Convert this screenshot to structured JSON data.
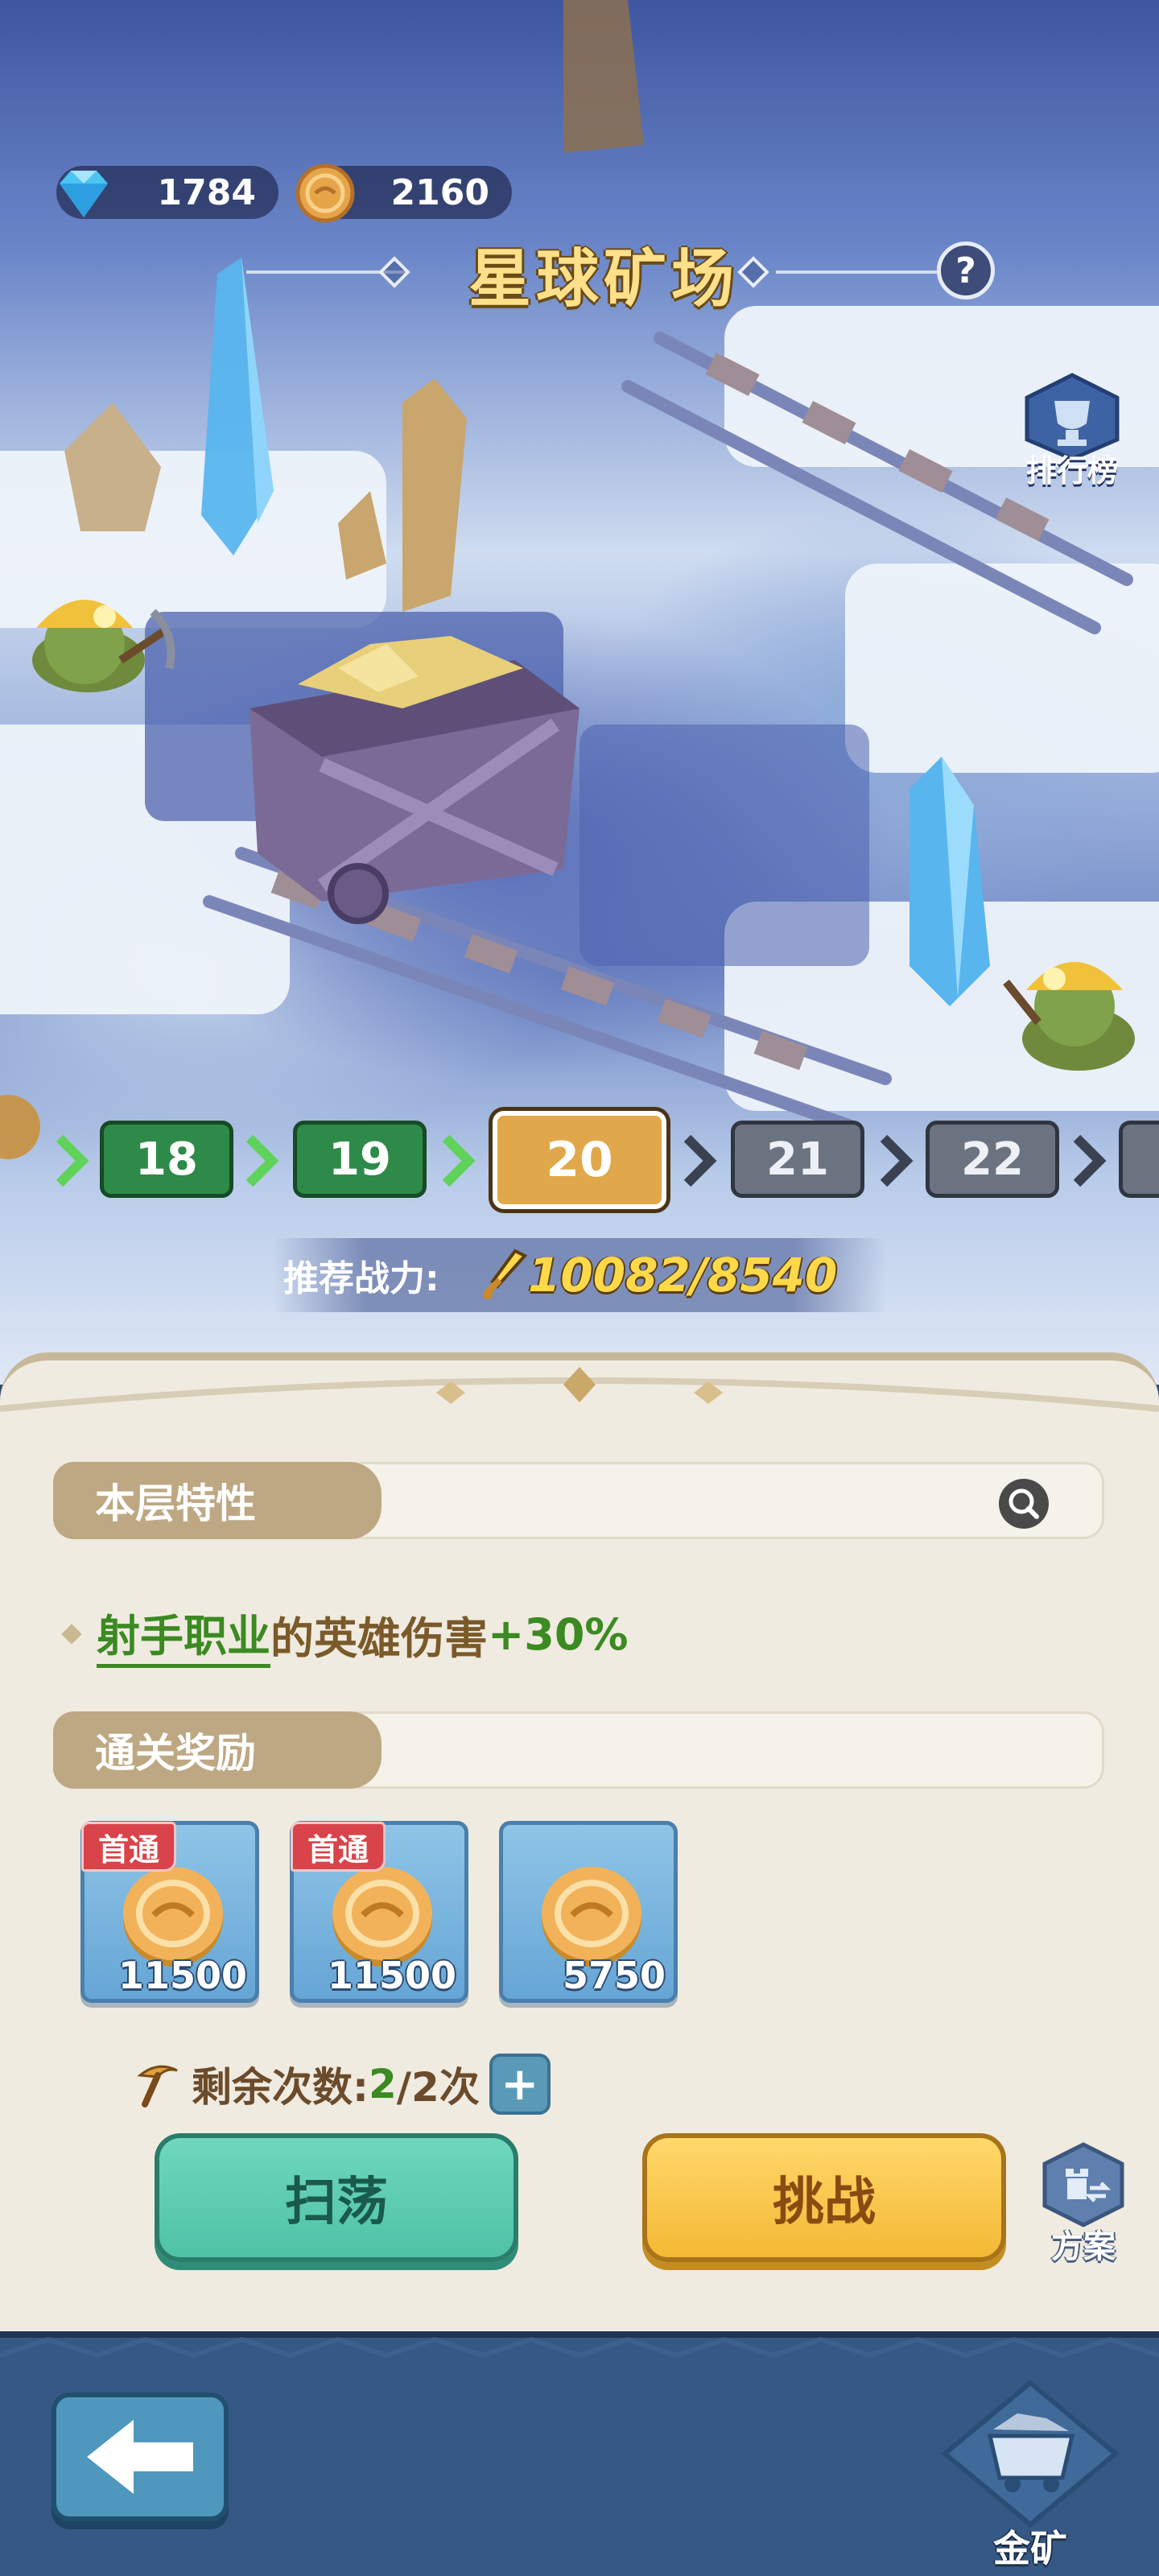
{
  "header": {
    "diamonds": "1784",
    "coins": "2160",
    "title": "星球矿场",
    "help_symbol": "?",
    "ranking_label": "排行榜"
  },
  "levels": {
    "items": [
      {
        "label": "18",
        "state": "cleared"
      },
      {
        "label": "19",
        "state": "cleared"
      },
      {
        "label": "20",
        "state": "current"
      },
      {
        "label": "21",
        "state": "locked"
      },
      {
        "label": "22",
        "state": "locked"
      }
    ]
  },
  "power": {
    "label": "推荐战力:",
    "value": "10082/8540"
  },
  "trait": {
    "section_label": "本层特性",
    "job": "射手职业",
    "middle": "的英雄伤害",
    "buff": "+30%"
  },
  "rewards": {
    "section_label": "通关奖励",
    "items": [
      {
        "badge": "首通",
        "qty": "11500",
        "icon": "gold-coin-icon"
      },
      {
        "badge": "首通",
        "qty": "11500",
        "icon": "gold-coin-icon"
      },
      {
        "badge": "",
        "qty": "5750",
        "icon": "gold-coin-icon"
      }
    ]
  },
  "attempts": {
    "label": "剩余次数:",
    "current": "2",
    "total": "/2次",
    "plus_symbol": "+"
  },
  "actions": {
    "sweep": "扫荡",
    "challenge": "挑战",
    "plan": "方案"
  },
  "bottom": {
    "mine_label": "金矿"
  },
  "colors": {
    "cleared": "#2e8a48",
    "current": "#e0a84a",
    "locked": "#6b7381",
    "buff_green": "#3b8a22",
    "sweep_teal": "#4fc2a6",
    "challenge_gold": "#f4b935"
  }
}
